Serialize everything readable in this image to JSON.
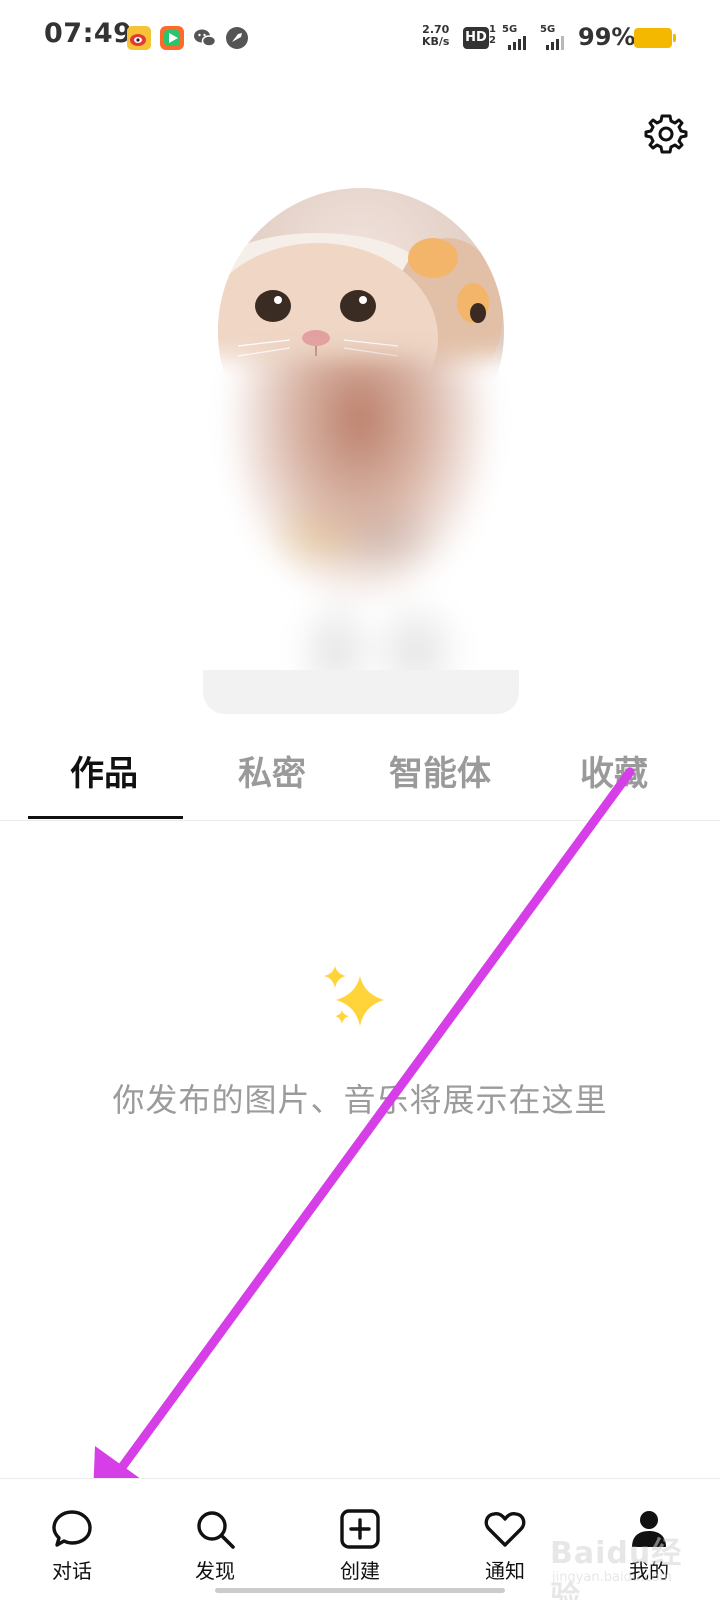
{
  "status_bar": {
    "time": "07:49",
    "net_speed_value": "2.70",
    "net_speed_unit": "KB/s",
    "hd_label": "HD",
    "hd_sub": "1\n2",
    "signal_1": "5G",
    "signal_2": "5G",
    "battery": "99%",
    "battery_color": "#f5b800",
    "app_icons": [
      "weibo-icon",
      "video-app-icon",
      "wechat-icon",
      "navigation-app-icon"
    ]
  },
  "header": {
    "settings_icon": "gear-icon"
  },
  "profile": {
    "avatar": "cat-avatar",
    "blurred": true
  },
  "tabs": [
    {
      "label": "作品",
      "active": true
    },
    {
      "label": "私密",
      "active": false
    },
    {
      "label": "智能体",
      "active": false
    },
    {
      "label": "收藏",
      "active": false
    }
  ],
  "empty_state": {
    "icon": "sparkles-icon",
    "text": "你发布的图片、音乐将展示在这里"
  },
  "bottom_nav": [
    {
      "label": "对话",
      "icon": "chat-bubble-icon"
    },
    {
      "label": "发现",
      "icon": "search-icon"
    },
    {
      "label": "创建",
      "icon": "plus-square-icon"
    },
    {
      "label": "通知",
      "icon": "heart-icon"
    },
    {
      "label": "我的",
      "icon": "user-icon"
    }
  ],
  "annotation": {
    "color": "#d63ee8"
  },
  "watermark": {
    "brand": "Baidu经验",
    "url": "jingyan.baidu.com"
  }
}
